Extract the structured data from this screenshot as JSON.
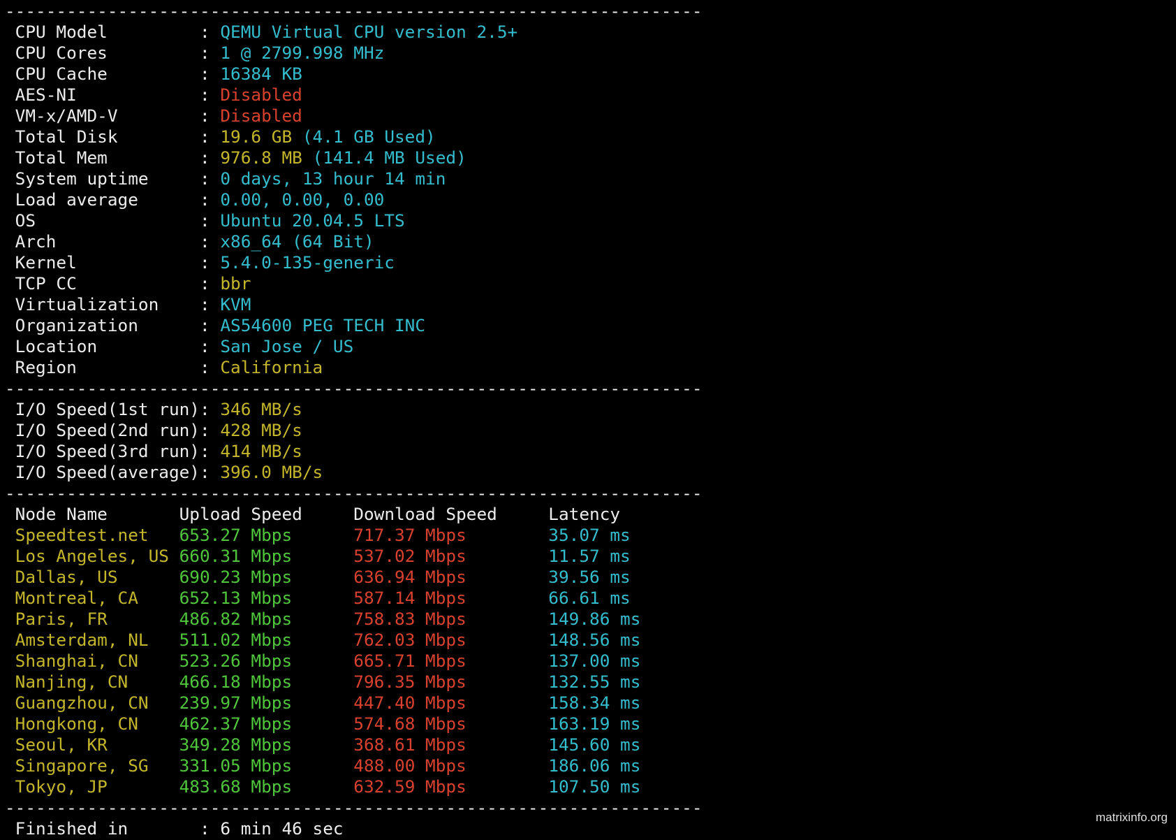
{
  "separator": "--------------------------------------------------------------------",
  "colors": {
    "label": "#ececec",
    "cyan": "#34bdcd",
    "red": "#d9412f",
    "yellow": "#c4b62b",
    "green": "#4fc63b"
  },
  "system_info": [
    {
      "label": "CPU Model",
      "parts": [
        {
          "text": "QEMU Virtual CPU version 2.5+",
          "color": "c"
        }
      ]
    },
    {
      "label": "CPU Cores",
      "parts": [
        {
          "text": "1 @ 2799.998 MHz",
          "color": "c"
        }
      ]
    },
    {
      "label": "CPU Cache",
      "parts": [
        {
          "text": "16384 KB",
          "color": "c"
        }
      ]
    },
    {
      "label": "AES-NI",
      "parts": [
        {
          "text": "Disabled",
          "color": "r"
        }
      ]
    },
    {
      "label": "VM-x/AMD-V",
      "parts": [
        {
          "text": "Disabled",
          "color": "r"
        }
      ]
    },
    {
      "label": "Total Disk",
      "parts": [
        {
          "text": "19.6 GB",
          "color": "y"
        },
        {
          "text": " (4.1 GB Used)",
          "color": "c"
        }
      ]
    },
    {
      "label": "Total Mem",
      "parts": [
        {
          "text": "976.8 MB",
          "color": "y"
        },
        {
          "text": " (141.4 MB Used)",
          "color": "c"
        }
      ]
    },
    {
      "label": "System uptime",
      "parts": [
        {
          "text": "0 days, 13 hour 14 min",
          "color": "c"
        }
      ]
    },
    {
      "label": "Load average",
      "parts": [
        {
          "text": "0.00, 0.00, 0.00",
          "color": "c"
        }
      ]
    },
    {
      "label": "OS",
      "parts": [
        {
          "text": "Ubuntu 20.04.5 LTS",
          "color": "c"
        }
      ]
    },
    {
      "label": "Arch",
      "parts": [
        {
          "text": "x86_64 (64 Bit)",
          "color": "c"
        }
      ]
    },
    {
      "label": "Kernel",
      "parts": [
        {
          "text": "5.4.0-135-generic",
          "color": "c"
        }
      ]
    },
    {
      "label": "TCP CC",
      "parts": [
        {
          "text": "bbr",
          "color": "y"
        }
      ]
    },
    {
      "label": "Virtualization",
      "parts": [
        {
          "text": "KVM",
          "color": "c"
        }
      ]
    },
    {
      "label": "Organization",
      "parts": [
        {
          "text": "AS54600 PEG TECH INC",
          "color": "c"
        }
      ]
    },
    {
      "label": "Location",
      "parts": [
        {
          "text": "San Jose / US",
          "color": "c"
        }
      ]
    },
    {
      "label": "Region",
      "parts": [
        {
          "text": "California",
          "color": "y"
        }
      ]
    }
  ],
  "io_speed": [
    {
      "label": "I/O Speed(1st run)",
      "value": "346 MB/s"
    },
    {
      "label": "I/O Speed(2nd run)",
      "value": "428 MB/s"
    },
    {
      "label": "I/O Speed(3rd run)",
      "value": "414 MB/s"
    },
    {
      "label": "I/O Speed(average)",
      "value": "396.0 MB/s"
    }
  ],
  "speedtest": {
    "headers": [
      "Node Name",
      "Upload Speed",
      "Download Speed",
      "Latency"
    ],
    "rows": [
      [
        "Speedtest.net",
        "653.27 Mbps",
        "717.37 Mbps",
        "35.07 ms"
      ],
      [
        "Los Angeles, US",
        "660.31 Mbps",
        "537.02 Mbps",
        "11.57 ms"
      ],
      [
        "Dallas, US",
        "690.23 Mbps",
        "636.94 Mbps",
        "39.56 ms"
      ],
      [
        "Montreal, CA",
        "652.13 Mbps",
        "587.14 Mbps",
        "66.61 ms"
      ],
      [
        "Paris, FR",
        "486.82 Mbps",
        "758.83 Mbps",
        "149.86 ms"
      ],
      [
        "Amsterdam, NL",
        "511.02 Mbps",
        "762.03 Mbps",
        "148.56 ms"
      ],
      [
        "Shanghai, CN",
        "523.26 Mbps",
        "665.71 Mbps",
        "137.00 ms"
      ],
      [
        "Nanjing, CN",
        "466.18 Mbps",
        "796.35 Mbps",
        "132.55 ms"
      ],
      [
        "Guangzhou, CN",
        "239.97 Mbps",
        "447.40 Mbps",
        "158.34 ms"
      ],
      [
        "Hongkong, CN",
        "462.37 Mbps",
        "574.68 Mbps",
        "163.19 ms"
      ],
      [
        "Seoul, KR",
        "349.28 Mbps",
        "368.61 Mbps",
        "145.60 ms"
      ],
      [
        "Singapore, SG",
        "331.05 Mbps",
        "488.00 Mbps",
        "186.06 ms"
      ],
      [
        "Tokyo, JP",
        "483.68 Mbps",
        "632.59 Mbps",
        "107.50 ms"
      ]
    ]
  },
  "finished": {
    "label": "Finished in",
    "value": "6 min 46 sec"
  },
  "watermark": "matrixinfo.org"
}
